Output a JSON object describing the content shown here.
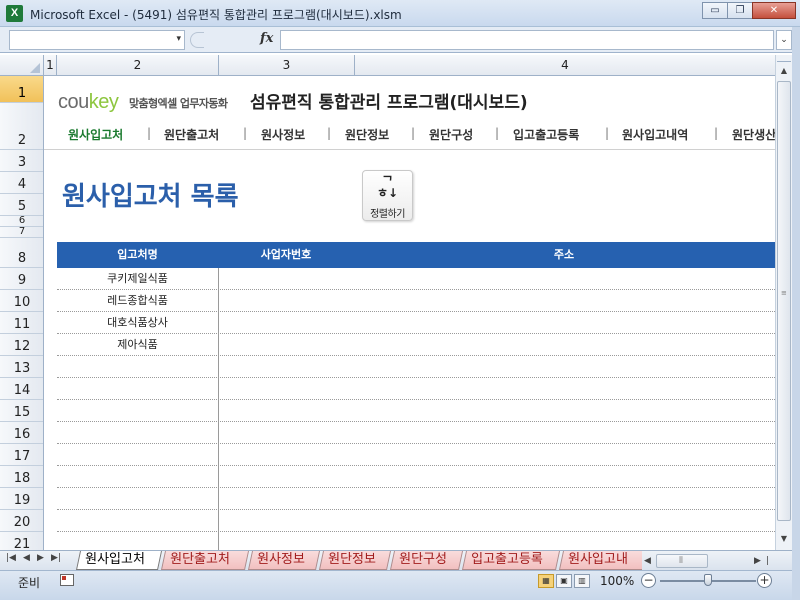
{
  "window": {
    "title": "Microsoft Excel - (5491) 섬유편직 통합관리 프로그램(대시보드).xlsm",
    "app_icon_glyph": "X",
    "minimize_glyph": "▭",
    "restore_glyph": "❐",
    "close_glyph": "✕"
  },
  "formula_bar": {
    "name_box": "",
    "name_box_arrow": "▾",
    "fx_label": "fx",
    "formula": "",
    "expand_glyph": "⌄"
  },
  "columns": [
    "1",
    "2",
    "3",
    "4"
  ],
  "rows": [
    "1",
    "2",
    "3",
    "4",
    "5",
    "6",
    "7",
    "8",
    "9",
    "10",
    "11",
    "12",
    "13",
    "14",
    "15",
    "16",
    "17",
    "18",
    "19",
    "20",
    "21"
  ],
  "header": {
    "logo_prefix": "cou",
    "logo_suffix": "key",
    "logo_tagline": "맞춤형엑셀 업무자동화",
    "app_title": "섬유편직 통합관리 프로그램(대시보드)"
  },
  "nav": {
    "separator": "|",
    "items": [
      "원사입고처",
      "원단출고처",
      "원사정보",
      "원단정보",
      "원단구성",
      "입고출고등록",
      "원사입고내역",
      "원단생산"
    ]
  },
  "page": {
    "heading": "원사입고처 목록",
    "sort_icon": "ᄀ",
    "sort_icon_b": "ㅎ↓",
    "sort_label": "정렬하기"
  },
  "table": {
    "headers": [
      "입고처명",
      "사업자번호",
      "주소"
    ],
    "rows": [
      [
        "쿠키제일식품",
        "",
        ""
      ],
      [
        "레드종합식품",
        "",
        ""
      ],
      [
        "대호식품상사",
        "",
        ""
      ],
      [
        "제아식품",
        "",
        ""
      ],
      [
        "",
        "",
        ""
      ],
      [
        "",
        "",
        ""
      ],
      [
        "",
        "",
        ""
      ],
      [
        "",
        "",
        ""
      ],
      [
        "",
        "",
        ""
      ],
      [
        "",
        "",
        ""
      ],
      [
        "",
        "",
        ""
      ],
      [
        "",
        "",
        ""
      ],
      [
        "",
        "",
        ""
      ]
    ]
  },
  "sheet_tabs": {
    "active": "원사입고처",
    "items": [
      "원사입고처",
      "원단출고처",
      "원사정보",
      "원단정보",
      "원단구성",
      "입고출고등록",
      "원사입고내"
    ]
  },
  "status_bar": {
    "status": "준비",
    "zoom": "100%",
    "zoom_minus": "−",
    "zoom_plus": "+",
    "zoom_fraction": 0.5
  },
  "colors": {
    "title_blue": "#2b5faa",
    "table_header_bg": "#2661b0",
    "nav_active": "#1a7a2e",
    "logo_green": "#8dc63f"
  }
}
